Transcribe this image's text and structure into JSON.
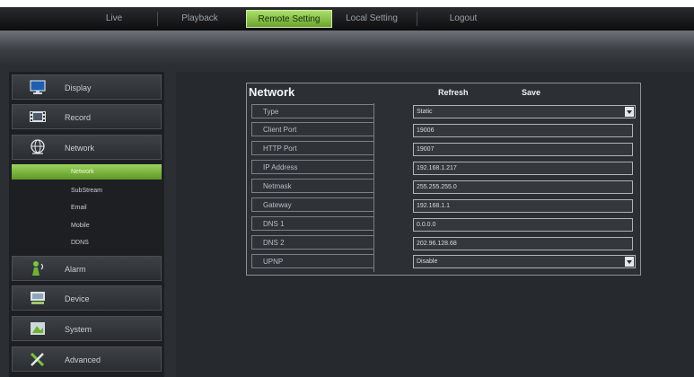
{
  "nav": {
    "tabs": [
      {
        "label": "Live"
      },
      {
        "label": "Playback"
      },
      {
        "label": "Remote Setting"
      },
      {
        "label": "Local Setting"
      },
      {
        "label": "Logout"
      }
    ],
    "active_tab": "Remote Setting"
  },
  "sidebar": {
    "items": [
      {
        "label": "Display",
        "icon": "monitor-icon"
      },
      {
        "label": "Record",
        "icon": "film-icon"
      },
      {
        "label": "Network",
        "icon": "globe-icon"
      },
      {
        "label": "Alarm",
        "icon": "alarm-icon"
      },
      {
        "label": "Device",
        "icon": "device-icon"
      },
      {
        "label": "System",
        "icon": "system-icon"
      },
      {
        "label": "Advanced",
        "icon": "tools-icon"
      }
    ],
    "network_subitems": [
      {
        "label": "Network"
      },
      {
        "label": "SubStream"
      },
      {
        "label": "Email"
      },
      {
        "label": "Mobile"
      },
      {
        "label": "DDNS"
      }
    ],
    "active_subitem": "Network"
  },
  "form": {
    "title": "Network",
    "refresh_label": "Refresh",
    "save_label": "Save",
    "rows": [
      {
        "label": "Type",
        "value": "Static"
      },
      {
        "label": "Client Port",
        "value": "19006"
      },
      {
        "label": "HTTP Port",
        "value": "19007"
      },
      {
        "label": "IP Address",
        "value": "192.168.1.217"
      },
      {
        "label": "Netmask",
        "value": "255.255.255.0"
      },
      {
        "label": "Gateway",
        "value": "192.168.1.1"
      },
      {
        "label": "DNS 1",
        "value": "0.0.0.0"
      },
      {
        "label": "DNS 2",
        "value": "202.96.128.68"
      },
      {
        "label": "UPNP",
        "value": "Disable"
      }
    ]
  },
  "colors": {
    "accent": "#7fba3e",
    "background": "#2b2e33"
  }
}
